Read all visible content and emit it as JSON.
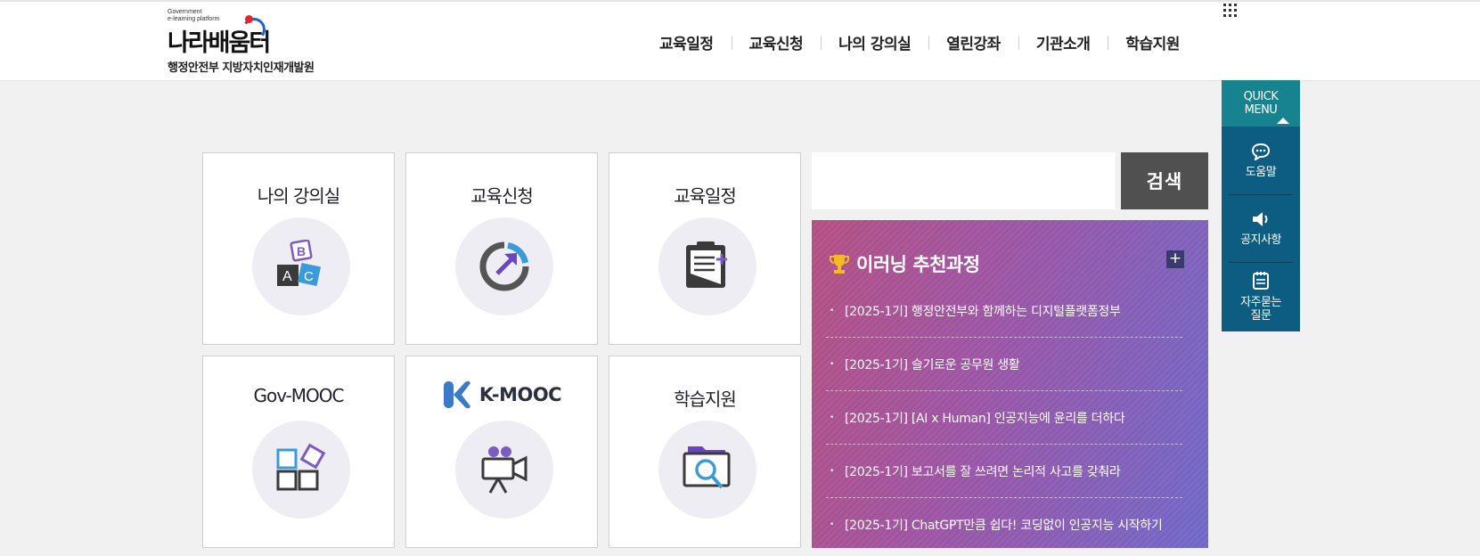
{
  "logo": {
    "en_line1": "Government",
    "en_line2": "e-learning platform",
    "ko": "나라배움터",
    "sub": "행정안전부 지방자치인재개발원"
  },
  "gnb": [
    "교육일정",
    "교육신청",
    "나의 강의실",
    "열린강좌",
    "기관소개",
    "학습지원"
  ],
  "tiles": [
    {
      "label": "나의 강의실",
      "icon": "abc-blocks-icon"
    },
    {
      "label": "교육신청",
      "icon": "progress-arrow-icon"
    },
    {
      "label": "교육일정",
      "icon": "clipboard-icon"
    },
    {
      "label": "Gov-MOOC",
      "icon": "shapes-icon"
    },
    {
      "label": "K-MOOC",
      "icon": "video-camera-icon"
    },
    {
      "label": "학습지원",
      "icon": "folder-search-icon"
    }
  ],
  "search": {
    "placeholder": "",
    "button": "검색"
  },
  "recommend": {
    "title": "이러닝 추천과정",
    "more": "+",
    "items": [
      "[2025-1기] 행정안전부와 함께하는 디지털플랫폼정부",
      "[2025-1기] 슬기로운 공무원 생활",
      "[2025-1기] [AI x Human] 인공지능에 윤리를 더하다",
      "[2025-1기] 보고서를 잘 쓰려면 논리적 사고를 갖춰라",
      "[2025-1기] ChatGPT만큼 쉽다! 코딩없이 인공지능 시작하기"
    ]
  },
  "quick": {
    "title_line1": "QUICK",
    "title_line2": "MENU",
    "items": [
      {
        "line1": "도움말",
        "line2": "",
        "icon": "chat-bubble-icon"
      },
      {
        "line1": "공지사항",
        "line2": "",
        "icon": "speaker-icon"
      },
      {
        "line1": "자주묻는",
        "line2": "질문",
        "icon": "notepad-icon"
      }
    ]
  },
  "colors": {
    "tile_circle": "#eeedf3",
    "search_button": "#505050",
    "recommend_start": "#b44f82",
    "recommend_end": "#6f68c8",
    "quick_head": "#16838f",
    "quick_body": "#0d5d82"
  }
}
